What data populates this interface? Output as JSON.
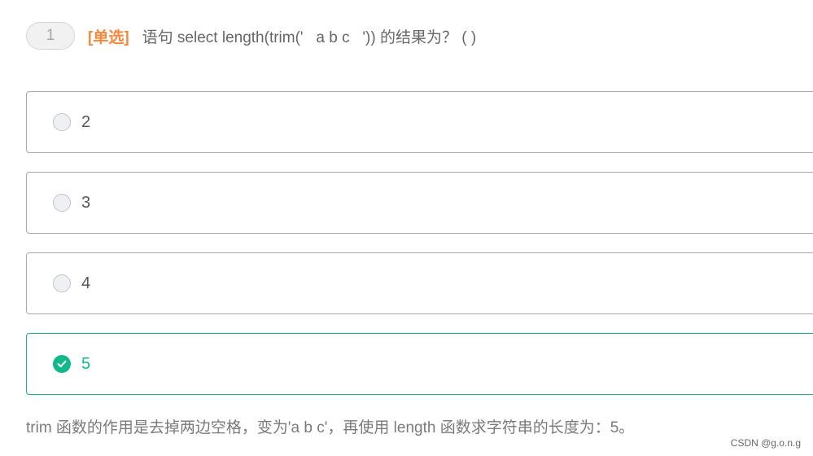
{
  "question": {
    "number": "1",
    "type_label": "[单选]",
    "text": "语句 select length(trim('   a b c   ')) 的结果为？ ( )"
  },
  "options": [
    {
      "label": "2",
      "selected": false
    },
    {
      "label": "3",
      "selected": false
    },
    {
      "label": "4",
      "selected": false
    },
    {
      "label": "5",
      "selected": true
    }
  ],
  "analysis": "trim 函数的作用是去掉两边空格，变为'a b c'，再使用 length 函数求字符串的长度为：5。",
  "watermark": "CSDN @g.o.n.g",
  "colors": {
    "accent_green": "#13b88b",
    "type_orange": "#f5883c",
    "border_gray": "#a8a8a8"
  }
}
